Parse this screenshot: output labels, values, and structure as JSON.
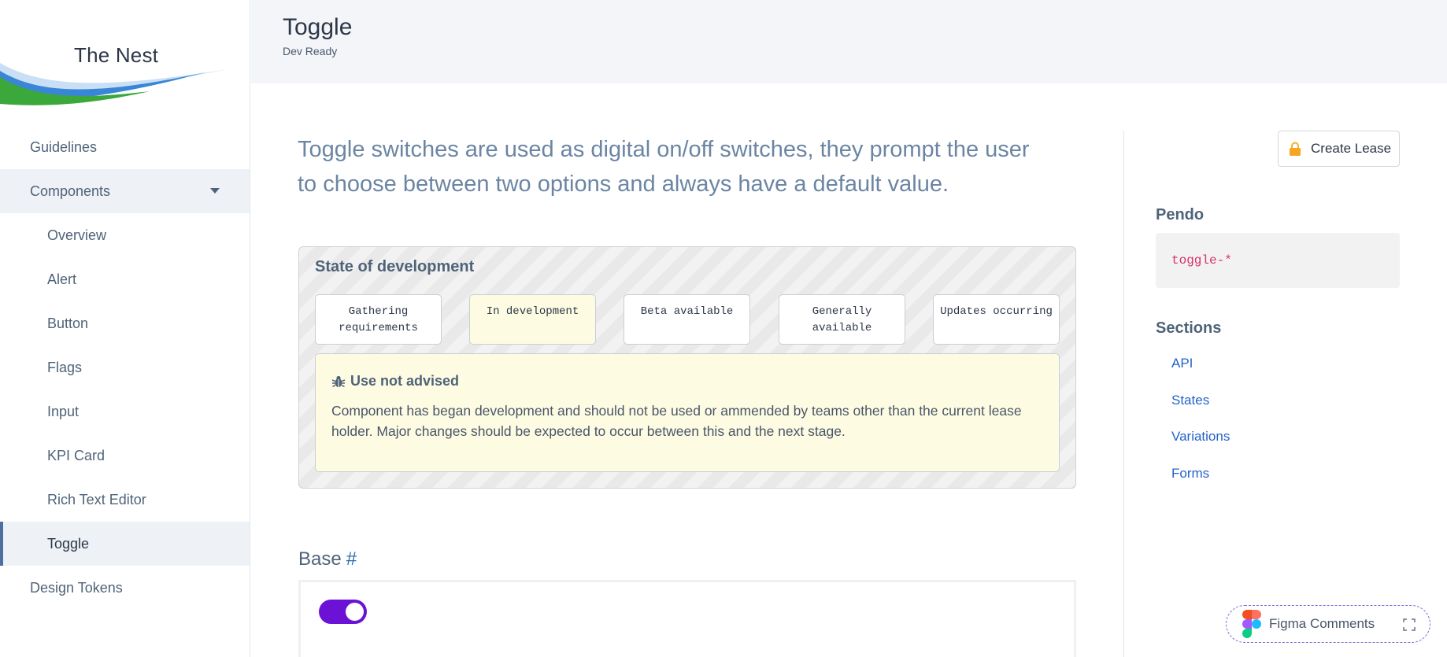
{
  "brand": {
    "title": "The Nest"
  },
  "sidebar": {
    "items": [
      {
        "label": "Guidelines"
      },
      {
        "label": "Components"
      },
      {
        "label": "Overview"
      },
      {
        "label": "Alert"
      },
      {
        "label": "Button"
      },
      {
        "label": "Flags"
      },
      {
        "label": "Input"
      },
      {
        "label": "KPI Card"
      },
      {
        "label": "Rich Text Editor"
      },
      {
        "label": "Toggle"
      },
      {
        "label": "Design Tokens"
      }
    ]
  },
  "header": {
    "title": "Toggle",
    "status": "Dev Ready"
  },
  "main": {
    "intro": "Toggle switches are used as digital on/off switches, they prompt the user to choose between two options and always have a default value.",
    "state": {
      "title": "State of development",
      "stages": [
        {
          "label": "Gathering requirements"
        },
        {
          "label": "In development"
        },
        {
          "label": "Beta available"
        },
        {
          "label": "Generally available"
        },
        {
          "label": "Updates occurring"
        }
      ],
      "current_stage": "In development",
      "notice_title": "Use not advised",
      "notice_body": "Component has began development and should not be used or ammended by teams other than the current lease holder. Major changes should be expected to occur between this and the next stage."
    },
    "base": {
      "heading": "Base",
      "anchor": "#",
      "toggle_on": true
    }
  },
  "rail": {
    "lease_button": "Create Lease",
    "pendo_heading": "Pendo",
    "pendo_code": "toggle-*",
    "sections_heading": "Sections",
    "sections": [
      {
        "label": "API"
      },
      {
        "label": "States"
      },
      {
        "label": "Variations"
      },
      {
        "label": "Forms"
      }
    ]
  },
  "figma": {
    "label": "Figma Comments"
  },
  "colors": {
    "accent": "#6b12d6",
    "link": "#2563c9",
    "notice_bg": "#fdfce3",
    "code": "#d6336c"
  }
}
